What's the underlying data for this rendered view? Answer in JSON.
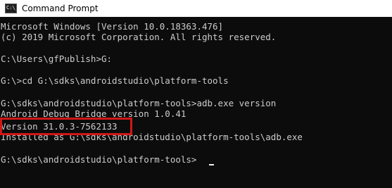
{
  "window": {
    "title": "Command Prompt",
    "icon": "cmd-icon",
    "icon_glyph": "C:\\_"
  },
  "console": {
    "lines": [
      "Microsoft Windows [Version 10.0.18363.476]",
      "(c) 2019 Microsoft Corporation. All rights reserved.",
      "",
      "C:\\Users\\gfPublish>G:",
      "",
      "G:\\>cd G:\\sdks\\androidstudio\\platform-tools",
      "",
      "G:\\sdks\\androidstudio\\platform-tools>adb.exe version",
      "Android Debug Bridge version 1.0.41",
      "Version 31.0.3-7562133",
      "Installed as G:\\sdks\\androidstudio\\platform-tools\\adb.exe",
      "",
      "G:\\sdks\\androidstudio\\platform-tools>"
    ]
  },
  "colors": {
    "console_bg": "#0c0c0c",
    "console_text": "#cccccc",
    "highlight": "#d01717"
  }
}
